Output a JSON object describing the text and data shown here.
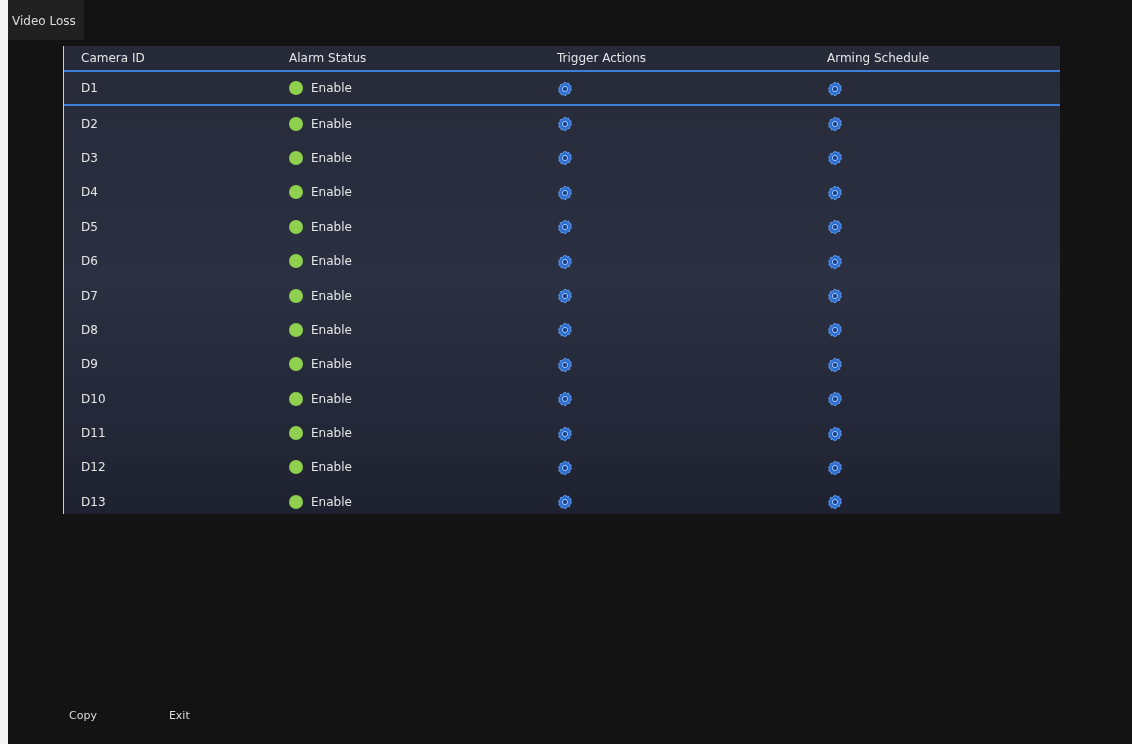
{
  "window": {
    "title": "Video Loss"
  },
  "table": {
    "columns": [
      "Camera ID",
      "Alarm Status",
      "Trigger Actions",
      "Arming Schedule"
    ],
    "rows": [
      {
        "camera_id": "D1",
        "status": "Enable",
        "enabled": true,
        "selected": true
      },
      {
        "camera_id": "D2",
        "status": "Enable",
        "enabled": true,
        "selected": false
      },
      {
        "camera_id": "D3",
        "status": "Enable",
        "enabled": true,
        "selected": false
      },
      {
        "camera_id": "D4",
        "status": "Enable",
        "enabled": true,
        "selected": false
      },
      {
        "camera_id": "D5",
        "status": "Enable",
        "enabled": true,
        "selected": false
      },
      {
        "camera_id": "D6",
        "status": "Enable",
        "enabled": true,
        "selected": false
      },
      {
        "camera_id": "D7",
        "status": "Enable",
        "enabled": true,
        "selected": false
      },
      {
        "camera_id": "D8",
        "status": "Enable",
        "enabled": true,
        "selected": false
      },
      {
        "camera_id": "D9",
        "status": "Enable",
        "enabled": true,
        "selected": false
      },
      {
        "camera_id": "D10",
        "status": "Enable",
        "enabled": true,
        "selected": false
      },
      {
        "camera_id": "D11",
        "status": "Enable",
        "enabled": true,
        "selected": false
      },
      {
        "camera_id": "D12",
        "status": "Enable",
        "enabled": true,
        "selected": false
      },
      {
        "camera_id": "D13",
        "status": "Enable",
        "enabled": true,
        "selected": false
      }
    ]
  },
  "buttons": [
    "Copy",
    "Exit"
  ]
}
